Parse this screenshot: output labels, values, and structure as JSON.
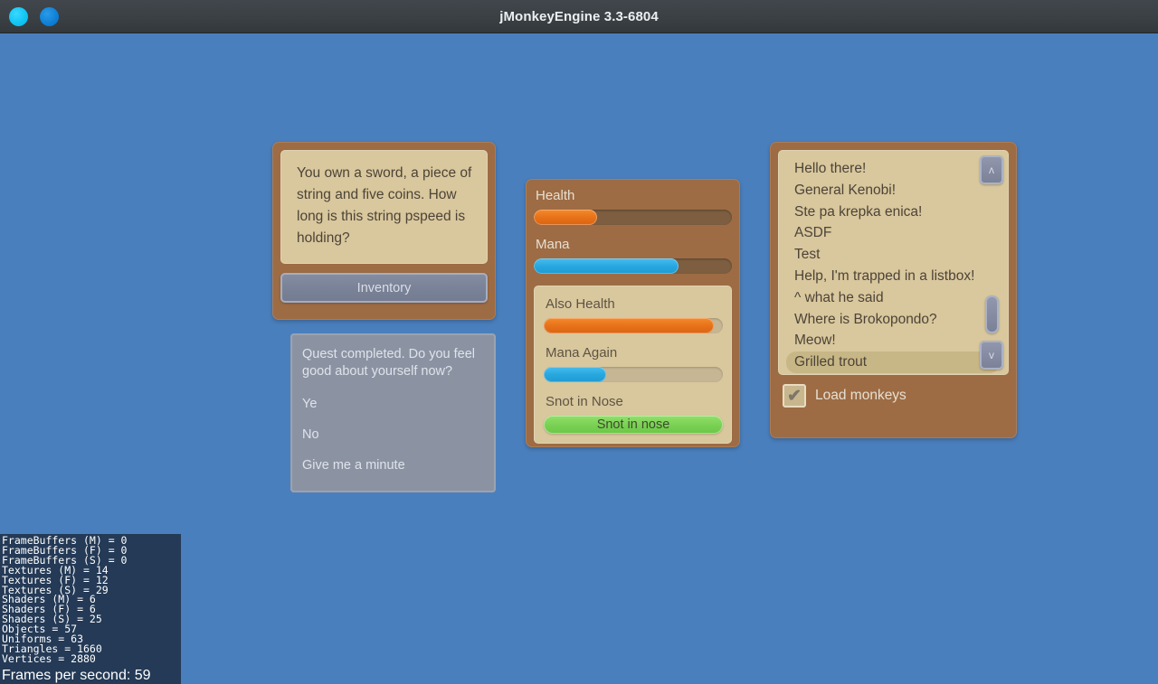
{
  "window": {
    "title": "jMonkeyEngine 3.3-6804",
    "buttons": [
      {
        "name": "window-button-cyan",
        "color": "#0fc3f3"
      },
      {
        "name": "window-button-blue",
        "color": "#0e7fd6"
      }
    ],
    "background_color": "#4a7fbd"
  },
  "dialog_panel": {
    "text": "You own a sword, a piece of string and five coins. How long is this string pspeed is holding?",
    "inventory_button_label": "Inventory"
  },
  "quest_panel": {
    "prompt": "Quest completed. Do you feel good about yourself now?",
    "options": [
      {
        "label": "Ye"
      },
      {
        "label": "No"
      },
      {
        "label": "Give me a minute"
      }
    ]
  },
  "stats_panel": {
    "bars": [
      {
        "label": "Health",
        "percent": 32,
        "color": "#e8731a",
        "track": "dark"
      },
      {
        "label": "Mana",
        "percent": 73,
        "color": "#29a8e0",
        "track": "dark"
      }
    ],
    "nested": {
      "bars": [
        {
          "label": "Also Health",
          "percent": 95,
          "color": "#e8731a",
          "track": "light"
        },
        {
          "label": "Mana Again",
          "percent": 35,
          "color": "#29a8e0",
          "track": "light"
        }
      ],
      "snot_label": "Snot in Nose",
      "snot_button_label": "Snot in nose",
      "snot_button_color": "#7bd255"
    }
  },
  "listbox_panel": {
    "items": [
      {
        "label": "Hello there!",
        "selected": false
      },
      {
        "label": "General Kenobi!",
        "selected": false
      },
      {
        "label": "Ste pa krepka enica!",
        "selected": false
      },
      {
        "label": "ASDF",
        "selected": false
      },
      {
        "label": "Test",
        "selected": false
      },
      {
        "label": "Help, I'm trapped in a listbox!",
        "selected": false
      },
      {
        "label": "^ what he said",
        "selected": false
      },
      {
        "label": "Where is Brokopondo?",
        "selected": false
      },
      {
        "label": "Meow!",
        "selected": false
      },
      {
        "label": "Grilled trout",
        "selected": true
      }
    ],
    "scroll_up_glyph": "ʌ",
    "scroll_down_glyph": "v",
    "checkbox": {
      "label": "Load monkeys",
      "checked": true,
      "check_glyph": "✔"
    }
  },
  "stats_overlay": {
    "lines": [
      "FrameBuffers (M) = 0",
      "FrameBuffers (F) = 0",
      "FrameBuffers (S) = 0",
      "Textures (M) = 14",
      "Textures (F) = 12",
      "Textures (S) = 29",
      "Shaders (M) = 6",
      "Shaders (F) = 6",
      "Shaders (S) = 25",
      "Objects = 57",
      "Uniforms = 63",
      "Triangles = 1660",
      "Vertices = 2880"
    ],
    "fps": "Frames per second: 59"
  }
}
